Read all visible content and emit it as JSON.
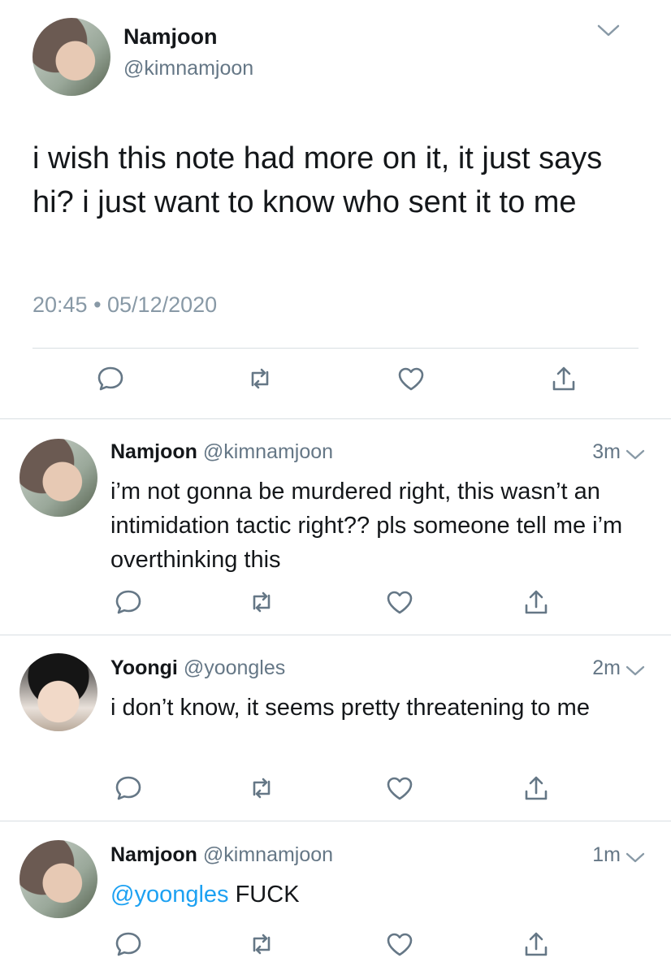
{
  "main_tweet": {
    "name": "Namjoon",
    "handle": "@kimnamjoon",
    "text": "i wish this note had more on it, it just says hi? i just want to know who sent it to me",
    "timestamp": "20:45 • 05/12/2020"
  },
  "replies": [
    {
      "name": "Namjoon",
      "handle": "@kimnamjoon",
      "time": "3m",
      "text": "i’m not gonna be murdered right, this wasn’t an intimidation tactic right?? pls someone tell me i’m overthinking this"
    },
    {
      "name": "Yoongi",
      "handle": "@yoongles",
      "time": "2m",
      "text": "i don’t know, it seems pretty threatening to me"
    },
    {
      "name": "Namjoon",
      "handle": "@kimnamjoon",
      "time": "1m",
      "mention": "@yoongles",
      "text": " FUCK"
    }
  ],
  "icons": {
    "reply": "speech-bubble-icon",
    "retweet": "retweet-icon",
    "like": "heart-icon",
    "share": "share-icon",
    "more": "chevron-down-icon"
  },
  "colors": {
    "text": "#14171a",
    "secondary": "#657786",
    "mention": "#1da1f2",
    "divider": "#d8dee2"
  }
}
